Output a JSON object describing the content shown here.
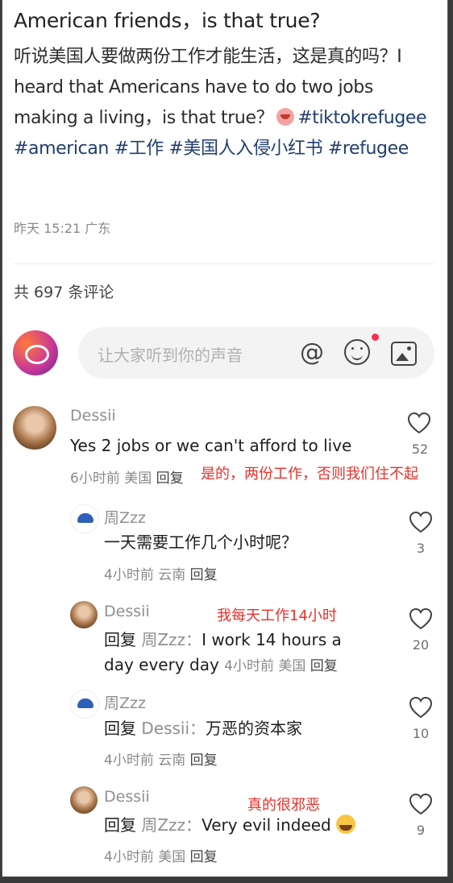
{
  "post": {
    "title": "American friends，is that true?",
    "body_prefix": "听说美国人要做两份工作才能生活，这是真的吗？I heard that Americans have to do two jobs making a living，is that true？",
    "tags": [
      "#tiktokrefugee",
      "#american",
      "#工作",
      "#美国人入侵小红书",
      "#refugee"
    ],
    "meta": "昨天 15:21 广东"
  },
  "comments_count": "共 697 条评论",
  "composer": {
    "placeholder": "让大家听到你的声音",
    "at_icon": "at-icon",
    "emoji_icon": "smiley-icon",
    "image_icon": "image-icon"
  },
  "comments": [
    {
      "user": "Dessii",
      "text": "Yes 2 jobs or we can't afford to live",
      "time": "6小时前",
      "location": "美国",
      "reply_label": "回复",
      "likes": "52",
      "annotation": "是的，两份工作，否则我们住不起"
    },
    {
      "user": "周Zzz",
      "text": "一天需要工作几个小时呢？",
      "time": "4小时前",
      "location": "云南",
      "reply_label": "回复",
      "likes": "3"
    },
    {
      "user": "Dessii",
      "reply_kw": "回复",
      "reply_to": "周Zzz：",
      "text1": "I work 14 hours a",
      "text2": "day every day",
      "time": "4小时前",
      "location": "美国",
      "reply_label": "回复",
      "likes": "20",
      "annotation": "我每天工作14小时"
    },
    {
      "user": "周Zzz",
      "reply_kw": "回复",
      "reply_to": "Dessii：",
      "text": "万恶的资本家",
      "time": "4小时前",
      "location": "云南",
      "reply_label": "回复",
      "likes": "10"
    },
    {
      "user": "Dessii",
      "reply_kw": "回复",
      "reply_to": "周Zzz：",
      "text": "Very evil indeed",
      "emoji": "crying-face-icon",
      "time": "4小时前",
      "location": "美国",
      "reply_label": "回复",
      "likes": "9",
      "annotation": "真的很邪恶"
    }
  ]
}
